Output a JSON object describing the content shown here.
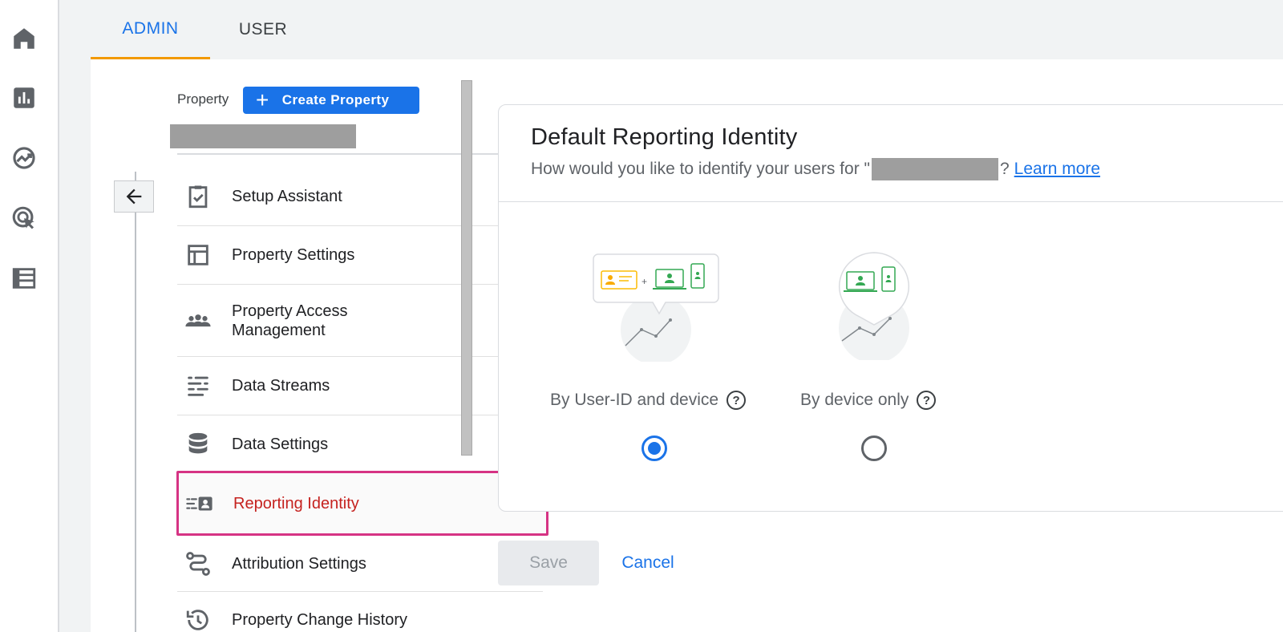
{
  "rail": {
    "icons": [
      "home-icon",
      "reports-icon",
      "explore-icon",
      "advertising-icon",
      "configure-icon"
    ]
  },
  "tabs": {
    "admin": "ADMIN",
    "user": "USER"
  },
  "property": {
    "label": "Property",
    "create_button": "Create Property"
  },
  "nav": {
    "items": [
      {
        "label": "Setup Assistant",
        "icon": "clipboard-check-icon"
      },
      {
        "label": "Property Settings",
        "icon": "layout-icon"
      },
      {
        "label": "Property Access Management",
        "icon": "people-icon"
      },
      {
        "label": "Data Streams",
        "icon": "streams-icon"
      },
      {
        "label": "Data Settings",
        "icon": "database-icon"
      },
      {
        "label": "Reporting Identity",
        "icon": "identity-icon",
        "active": true
      },
      {
        "label": "Attribution Settings",
        "icon": "route-icon"
      },
      {
        "label": "Property Change History",
        "icon": "history-icon"
      }
    ]
  },
  "card": {
    "title": "Default Reporting Identity",
    "subtitle_prefix": "How would you like to identify your users for \"",
    "subtitle_suffix": "?",
    "learn_more": "Learn more"
  },
  "options": [
    {
      "label": "By User-ID and device",
      "selected": true
    },
    {
      "label": "By device only",
      "selected": false
    }
  ],
  "actions": {
    "save": "Save",
    "cancel": "Cancel"
  },
  "colors": {
    "accent": "#1a73e8",
    "tab_underline": "#f29900",
    "highlight_border": "#d63384",
    "active_text": "#c5221f"
  }
}
